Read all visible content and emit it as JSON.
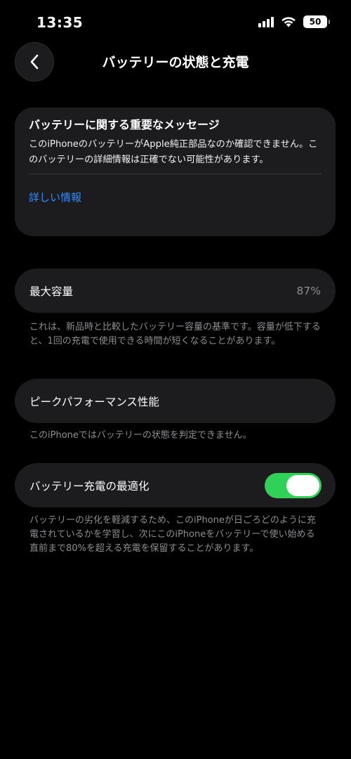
{
  "status_bar": {
    "time": "13:35",
    "battery_level": "50"
  },
  "header": {
    "title": "バッテリーの状態と充電"
  },
  "message_card": {
    "title": "バッテリーに関する重要なメッセージ",
    "body": "このiPhoneのバッテリーがApple純正部品なのか確認できません。このバッテリーの詳細情報は正確でない可能性があります。",
    "link_label": "詳しい情報"
  },
  "max_capacity": {
    "label": "最大容量",
    "value": "87%",
    "footnote": "これは、新品時と比較したバッテリー容量の基準です。容量が低下すると、1回の充電で使用できる時間が短くなることがあります。"
  },
  "peak_performance": {
    "label": "ピークパフォーマンス性能",
    "footnote": "このiPhoneではバッテリーの状態を判定できません。"
  },
  "optimized_charging": {
    "label": "バッテリー充電の最適化",
    "enabled": true,
    "footnote": "バッテリーの劣化を軽減するため、このiPhoneが日ごろどのように充電されているかを学習し、次にこのiPhoneをバッテリーで使い始める直前まで80%を超える充電を保留することがあります。"
  },
  "colors": {
    "background": "#000000",
    "card": "#1c1c1e",
    "link": "#2f8cff",
    "toggle_on": "#30d158",
    "secondary_text": "#8e8e93"
  },
  "icons": {
    "back": "chevron-left-icon",
    "signal": "cellular-signal-icon",
    "wifi": "wifi-icon",
    "battery": "battery-icon"
  }
}
